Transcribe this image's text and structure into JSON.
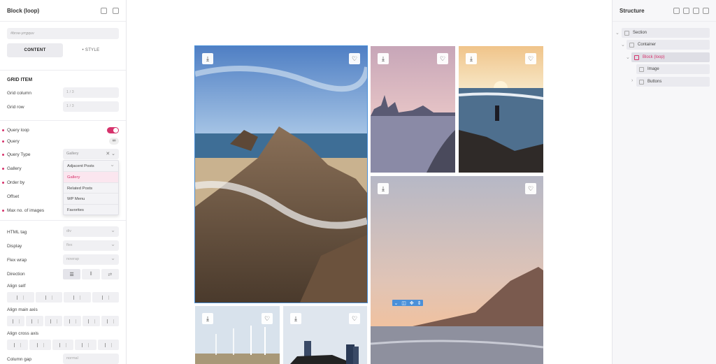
{
  "left_panel": {
    "title": "Block (loop)",
    "element_id": "#brxe-yrrgquv",
    "tabs": [
      "CONTENT",
      "• STYLE"
    ],
    "grid_item": {
      "section_title": "GRID ITEM",
      "grid_column_label": "Grid column",
      "grid_column_value": "1 / 3",
      "grid_row_label": "Grid row",
      "grid_row_value": "1 / 3"
    },
    "query": {
      "query_loop_label": "Query loop",
      "query_label": "Query",
      "query_type_label": "Query Type",
      "query_type_value": "Gallery",
      "gallery_label": "Gallery",
      "order_by_label": "Order by",
      "offset_label": "Offset",
      "max_images_label": "Max no. of images",
      "options": [
        "Adjacent Posts",
        "Gallery",
        "Related Posts",
        "WP Menu",
        "Favorites"
      ]
    },
    "layout": {
      "html_tag_label": "HTML tag",
      "html_tag_value": "div",
      "display_label": "Display",
      "display_value": "flex",
      "flex_wrap_label": "Flex wrap",
      "flex_wrap_value": "nowrap",
      "direction_label": "Direction",
      "align_self_label": "Align self",
      "align_main_label": "Align main axis",
      "align_cross_label": "Align cross axis",
      "column_gap_label": "Column gap",
      "column_gap_value": "normal"
    }
  },
  "canvas": {
    "tiles": [
      {
        "name": "rocks-beach"
      },
      {
        "name": "city-marina"
      },
      {
        "name": "surfer-sunset"
      },
      {
        "name": "coast-cliff"
      },
      {
        "name": "wind-turbines"
      },
      {
        "name": "city-car"
      }
    ],
    "toolbar_icons": [
      "chevron-down-icon",
      "columns-icon",
      "move-icon",
      "drag-icon"
    ]
  },
  "right_panel": {
    "title": "Structure",
    "tree": [
      {
        "label": "Section"
      },
      {
        "label": "Container"
      },
      {
        "label": "Block (loop)"
      },
      {
        "label": "Image"
      },
      {
        "label": "Buttons"
      }
    ]
  },
  "colors": {
    "accent": "#d6336c",
    "selection": "#4a90d9"
  }
}
